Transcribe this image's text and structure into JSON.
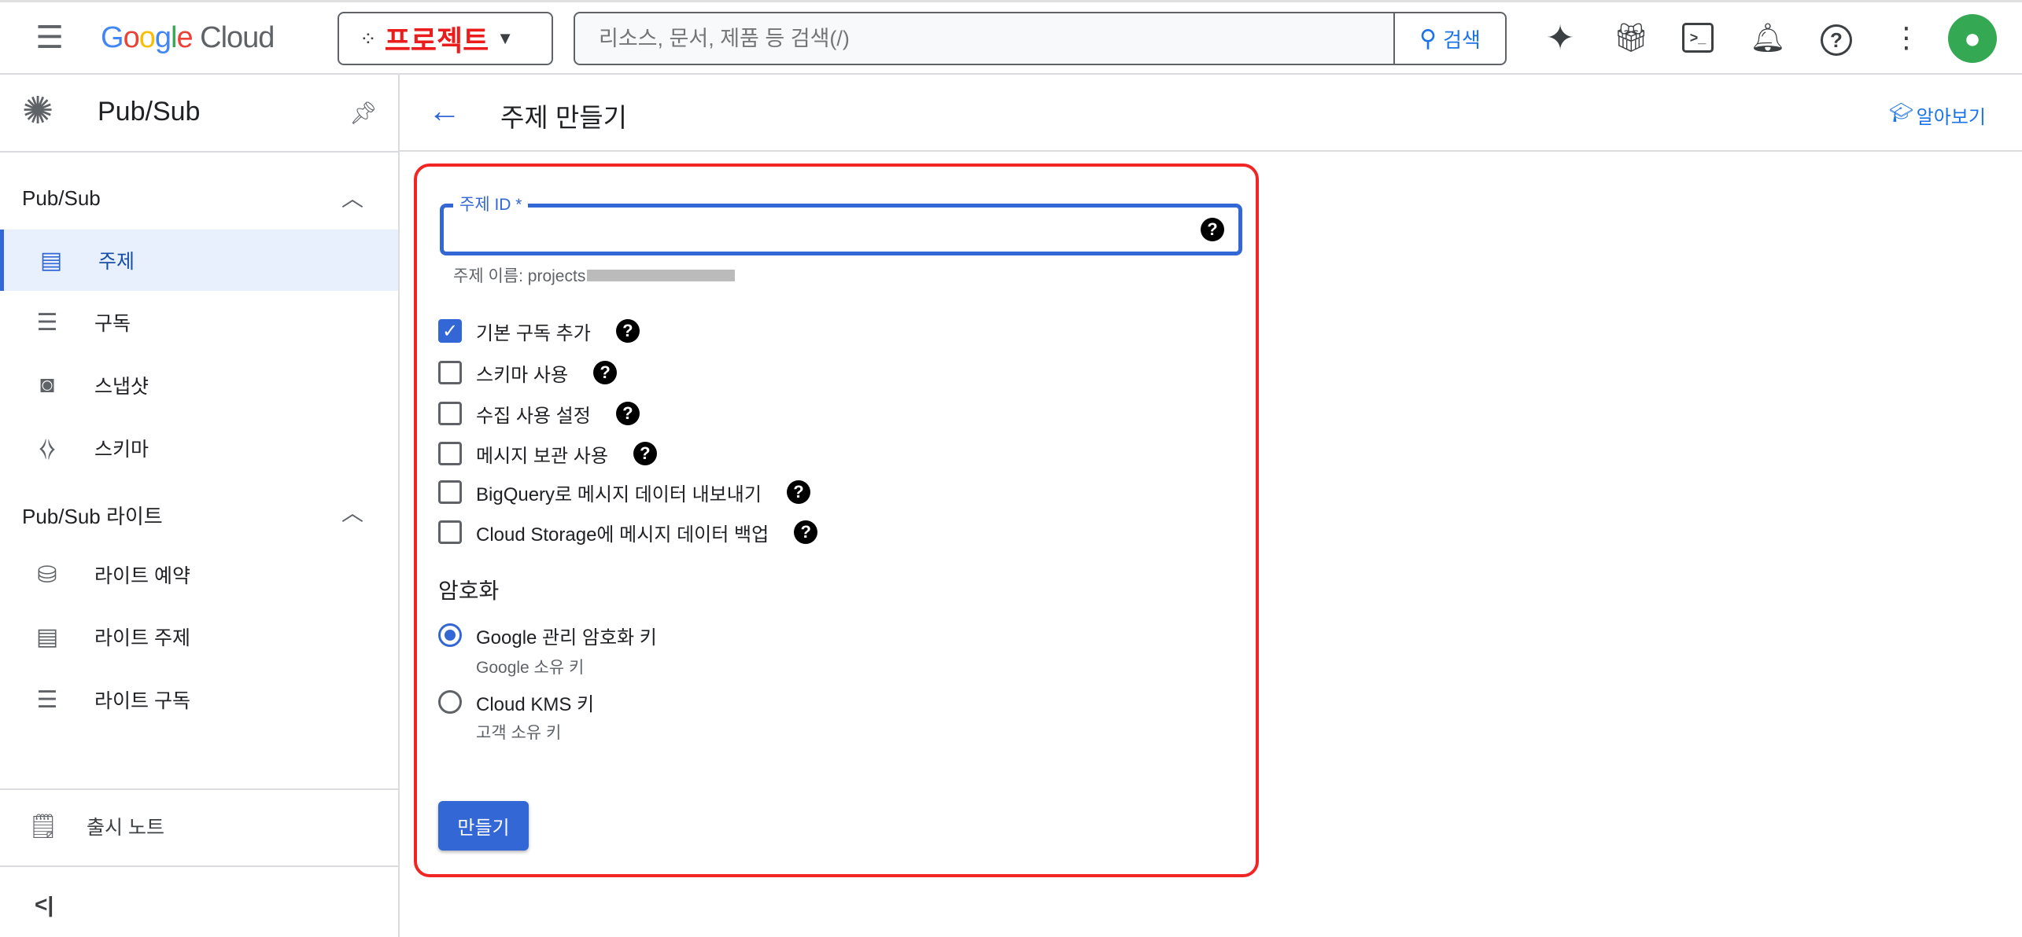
{
  "header": {
    "logo": "Google Cloud",
    "project": "프로젝트",
    "search_placeholder": "리소스, 문서, 제품 등 검색(/)",
    "search_button": "검색"
  },
  "sidebar": {
    "product": "Pub/Sub",
    "section1": "Pub/Sub",
    "items1": [
      {
        "label": "주제",
        "icon": "topic-icon"
      },
      {
        "label": "구독",
        "icon": "list-icon"
      },
      {
        "label": "스냅샷",
        "icon": "snapshot-icon"
      },
      {
        "label": "스키마",
        "icon": "schema-icon"
      }
    ],
    "section2": "Pub/Sub 라이트",
    "items2": [
      {
        "label": "라이트 예약",
        "icon": "reservation-icon"
      },
      {
        "label": "라이트 주제",
        "icon": "topic-icon"
      },
      {
        "label": "라이트 구독",
        "icon": "list-icon"
      }
    ],
    "release_notes": "출시 노트",
    "collapse": "<|"
  },
  "page": {
    "title": "주제 만들기",
    "learn": "알아보기"
  },
  "form": {
    "topic_id_label": "주제 ID *",
    "topic_id_value": "",
    "topic_name_prefix": "주제 이름: projects",
    "options": [
      {
        "label": "기본 구독 추가",
        "checked": true
      },
      {
        "label": "스키마 사용",
        "checked": false
      },
      {
        "label": "수집 사용 설정",
        "checked": false
      },
      {
        "label": "메시지 보관 사용",
        "checked": false
      },
      {
        "label": "BigQuery로 메시지 데이터 내보내기",
        "checked": false
      },
      {
        "label": "Cloud Storage에 메시지 데이터 백업",
        "checked": false
      }
    ],
    "encryption_title": "암호화",
    "encryption": [
      {
        "label": "Google 관리 암호화 키",
        "sub": "Google 소유 키",
        "selected": true
      },
      {
        "label": "Cloud KMS 키",
        "sub": "고객 소유 키",
        "selected": false
      }
    ],
    "create": "만들기"
  },
  "colors": {
    "accent": "#3367d6",
    "highlight_box": "#f22525",
    "project_text": "#ea1c1c"
  }
}
